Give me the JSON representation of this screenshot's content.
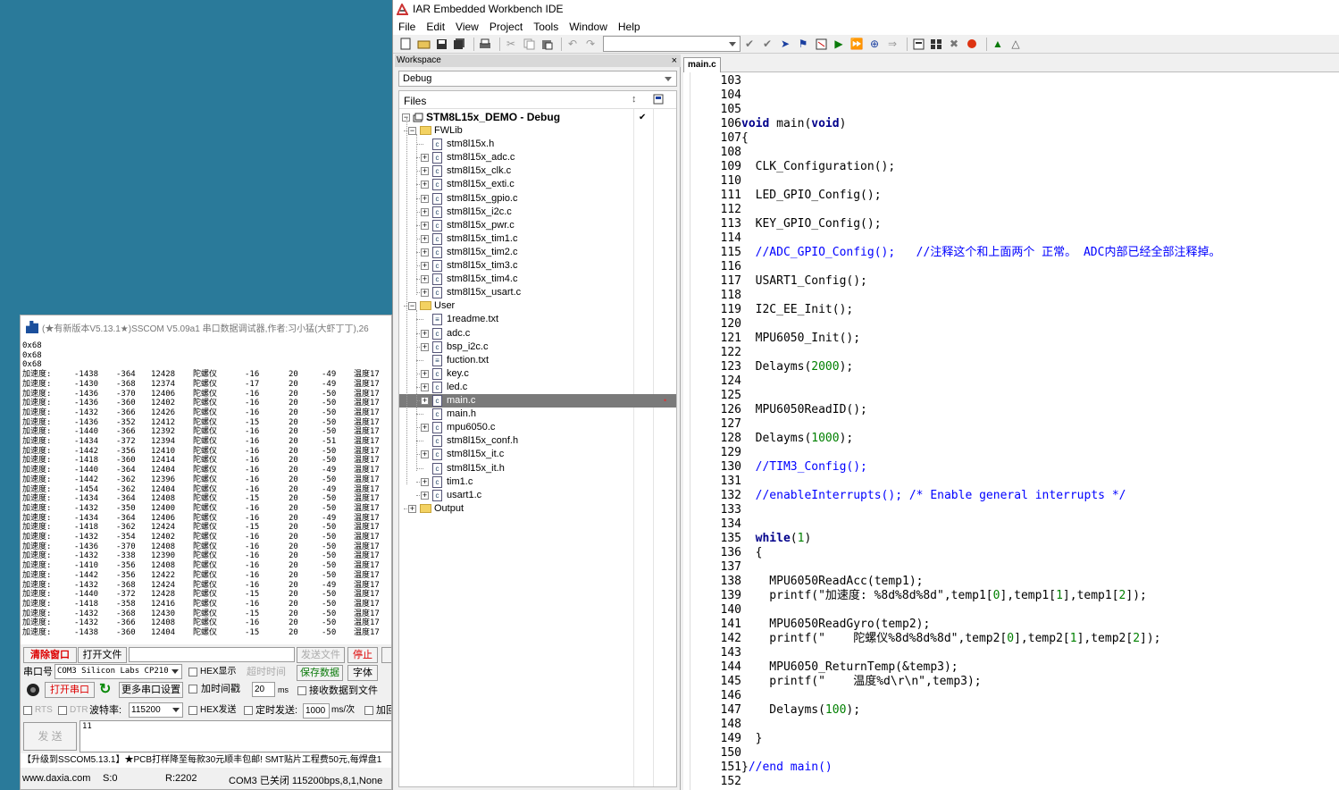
{
  "iar": {
    "title": "IAR Embedded Workbench IDE",
    "menu": [
      "File",
      "Edit",
      "View",
      "Project",
      "Tools",
      "Window",
      "Help"
    ],
    "workspace": {
      "header": "Workspace",
      "close": "×",
      "config": "Debug",
      "files_label": "Files",
      "project": "STM8L15x_DEMO - Debug",
      "project_check": "✔",
      "tree": [
        {
          "label": "FWLib",
          "type": "folder",
          "level": 1,
          "exp": "−"
        },
        {
          "label": "stm8l15x.h",
          "type": "file",
          "level": 2,
          "exp": ""
        },
        {
          "label": "stm8l15x_adc.c",
          "type": "file",
          "level": 2,
          "exp": "+"
        },
        {
          "label": "stm8l15x_clk.c",
          "type": "file",
          "level": 2,
          "exp": "+"
        },
        {
          "label": "stm8l15x_exti.c",
          "type": "file",
          "level": 2,
          "exp": "+"
        },
        {
          "label": "stm8l15x_gpio.c",
          "type": "file",
          "level": 2,
          "exp": "+"
        },
        {
          "label": "stm8l15x_i2c.c",
          "type": "file",
          "level": 2,
          "exp": "+"
        },
        {
          "label": "stm8l15x_pwr.c",
          "type": "file",
          "level": 2,
          "exp": "+"
        },
        {
          "label": "stm8l15x_tim1.c",
          "type": "file",
          "level": 2,
          "exp": "+"
        },
        {
          "label": "stm8l15x_tim2.c",
          "type": "file",
          "level": 2,
          "exp": "+"
        },
        {
          "label": "stm8l15x_tim3.c",
          "type": "file",
          "level": 2,
          "exp": "+"
        },
        {
          "label": "stm8l15x_tim4.c",
          "type": "file",
          "level": 2,
          "exp": "+"
        },
        {
          "label": "stm8l15x_usart.c",
          "type": "file",
          "level": 2,
          "exp": "+"
        },
        {
          "label": "User",
          "type": "folder",
          "level": 1,
          "exp": "−"
        },
        {
          "label": "1readme.txt",
          "type": "txt",
          "level": 2,
          "exp": ""
        },
        {
          "label": "adc.c",
          "type": "file",
          "level": 2,
          "exp": "+"
        },
        {
          "label": "bsp_i2c.c",
          "type": "file",
          "level": 2,
          "exp": "+"
        },
        {
          "label": "fuction.txt",
          "type": "txt",
          "level": 2,
          "exp": ""
        },
        {
          "label": "key.c",
          "type": "file",
          "level": 2,
          "exp": "+"
        },
        {
          "label": "led.c",
          "type": "file",
          "level": 2,
          "exp": "+"
        },
        {
          "label": "main.c",
          "type": "file",
          "level": 2,
          "exp": "+",
          "selected": true
        },
        {
          "label": "main.h",
          "type": "file",
          "level": 2,
          "exp": ""
        },
        {
          "label": "mpu6050.c",
          "type": "file",
          "level": 2,
          "exp": "+"
        },
        {
          "label": "stm8l15x_conf.h",
          "type": "file",
          "level": 2,
          "exp": ""
        },
        {
          "label": "stm8l15x_it.c",
          "type": "file",
          "level": 2,
          "exp": "+"
        },
        {
          "label": "stm8l15x_it.h",
          "type": "file",
          "level": 2,
          "exp": ""
        },
        {
          "label": "tim1.c",
          "type": "file",
          "level": 2,
          "exp": "+"
        },
        {
          "label": "usart1.c",
          "type": "file",
          "level": 2,
          "exp": "+"
        },
        {
          "label": "Output",
          "type": "folder",
          "level": 1,
          "exp": "+"
        }
      ]
    },
    "editor": {
      "tab": "main.c",
      "lines": [
        {
          "n": "103",
          "code": ""
        },
        {
          "n": "104",
          "code": ""
        },
        {
          "n": "105",
          "code": ""
        },
        {
          "n": "106",
          "code": "void main(void)"
        },
        {
          "n": "107",
          "code": "{"
        },
        {
          "n": "108",
          "code": ""
        },
        {
          "n": "109",
          "code": "  CLK_Configuration();"
        },
        {
          "n": "110",
          "code": ""
        },
        {
          "n": "111",
          "code": "  LED_GPIO_Config();"
        },
        {
          "n": "112",
          "code": ""
        },
        {
          "n": "113",
          "code": "  KEY_GPIO_Config();"
        },
        {
          "n": "114",
          "code": ""
        },
        {
          "n": "115",
          "code": "  //ADC_GPIO_Config();   //注释这个和上面两个 正常。 ADC内部已经全部注释掉。"
        },
        {
          "n": "116",
          "code": ""
        },
        {
          "n": "117",
          "code": "  USART1_Config();"
        },
        {
          "n": "118",
          "code": ""
        },
        {
          "n": "119",
          "code": "  I2C_EE_Init();"
        },
        {
          "n": "120",
          "code": ""
        },
        {
          "n": "121",
          "code": "  MPU6050_Init();"
        },
        {
          "n": "122",
          "code": ""
        },
        {
          "n": "123",
          "code": "  Delayms(2000);"
        },
        {
          "n": "124",
          "code": ""
        },
        {
          "n": "125",
          "code": ""
        },
        {
          "n": "126",
          "code": "  MPU6050ReadID();"
        },
        {
          "n": "127",
          "code": ""
        },
        {
          "n": "128",
          "code": "  Delayms(1000);"
        },
        {
          "n": "129",
          "code": ""
        },
        {
          "n": "130",
          "code": "  //TIM3_Config();"
        },
        {
          "n": "131",
          "code": ""
        },
        {
          "n": "132",
          "code": "  //enableInterrupts(); /* Enable general interrupts */"
        },
        {
          "n": "133",
          "code": ""
        },
        {
          "n": "134",
          "code": ""
        },
        {
          "n": "135",
          "code": "  while(1)"
        },
        {
          "n": "136",
          "code": "  {"
        },
        {
          "n": "137",
          "code": ""
        },
        {
          "n": "138",
          "code": "    MPU6050ReadAcc(temp1);"
        },
        {
          "n": "139",
          "code": "    printf(\"加速度: %8d%8d%8d\",temp1[0],temp1[1],temp1[2]);"
        },
        {
          "n": "140",
          "code": ""
        },
        {
          "n": "141",
          "code": "    MPU6050ReadGyro(temp2);"
        },
        {
          "n": "142",
          "code": "    printf(\"    陀螺仪%8d%8d%8d\",temp2[0],temp2[1],temp2[2]);"
        },
        {
          "n": "143",
          "code": ""
        },
        {
          "n": "144",
          "code": "    MPU6050_ReturnTemp(&temp3);"
        },
        {
          "n": "145",
          "code": "    printf(\"    温度%d\\r\\n\",temp3);"
        },
        {
          "n": "146",
          "code": ""
        },
        {
          "n": "147",
          "code": "    Delayms(100);"
        },
        {
          "n": "148",
          "code": ""
        },
        {
          "n": "149",
          "code": "  }"
        },
        {
          "n": "150",
          "code": ""
        },
        {
          "n": "151",
          "code": "}//end main()"
        },
        {
          "n": "152",
          "code": ""
        }
      ]
    }
  },
  "sscom": {
    "title": "(★有新版本V5.13.1★)SSCOM V5.09a1 串口数据调试器,作者:习小猛(大虾丁丁),26",
    "output_header": [
      "0x68",
      "0x68",
      "0x68"
    ],
    "rows": [
      [
        "加速度:",
        "-1438",
        "-364",
        "12428",
        "陀螺仪",
        "-16",
        "20",
        "-49",
        "温度17"
      ],
      [
        "加速度:",
        "-1430",
        "-368",
        "12374",
        "陀螺仪",
        "-17",
        "20",
        "-49",
        "温度17"
      ],
      [
        "加速度:",
        "-1436",
        "-370",
        "12406",
        "陀螺仪",
        "-16",
        "20",
        "-50",
        "温度17"
      ],
      [
        "加速度:",
        "-1436",
        "-360",
        "12402",
        "陀螺仪",
        "-16",
        "20",
        "-50",
        "温度17"
      ],
      [
        "加速度:",
        "-1432",
        "-366",
        "12426",
        "陀螺仪",
        "-16",
        "20",
        "-50",
        "温度17"
      ],
      [
        "加速度:",
        "-1436",
        "-352",
        "12412",
        "陀螺仪",
        "-15",
        "20",
        "-50",
        "温度17"
      ],
      [
        "加速度:",
        "-1440",
        "-366",
        "12392",
        "陀螺仪",
        "-16",
        "20",
        "-50",
        "温度17"
      ],
      [
        "加速度:",
        "-1434",
        "-372",
        "12394",
        "陀螺仪",
        "-16",
        "20",
        "-51",
        "温度17"
      ],
      [
        "加速度:",
        "-1442",
        "-356",
        "12410",
        "陀螺仪",
        "-16",
        "20",
        "-50",
        "温度17"
      ],
      [
        "加速度:",
        "-1418",
        "-360",
        "12414",
        "陀螺仪",
        "-16",
        "20",
        "-50",
        "温度17"
      ],
      [
        "加速度:",
        "-1440",
        "-364",
        "12404",
        "陀螺仪",
        "-16",
        "20",
        "-49",
        "温度17"
      ],
      [
        "加速度:",
        "-1442",
        "-362",
        "12396",
        "陀螺仪",
        "-16",
        "20",
        "-50",
        "温度17"
      ],
      [
        "加速度:",
        "-1454",
        "-362",
        "12404",
        "陀螺仪",
        "-16",
        "20",
        "-49",
        "温度17"
      ],
      [
        "加速度:",
        "-1434",
        "-364",
        "12408",
        "陀螺仪",
        "-15",
        "20",
        "-50",
        "温度17"
      ],
      [
        "加速度:",
        "-1432",
        "-350",
        "12400",
        "陀螺仪",
        "-16",
        "20",
        "-50",
        "温度17"
      ],
      [
        "加速度:",
        "-1434",
        "-364",
        "12406",
        "陀螺仪",
        "-16",
        "20",
        "-49",
        "温度17"
      ],
      [
        "加速度:",
        "-1418",
        "-362",
        "12424",
        "陀螺仪",
        "-15",
        "20",
        "-50",
        "温度17"
      ],
      [
        "加速度:",
        "-1432",
        "-354",
        "12402",
        "陀螺仪",
        "-16",
        "20",
        "-50",
        "温度17"
      ],
      [
        "加速度:",
        "-1436",
        "-370",
        "12408",
        "陀螺仪",
        "-16",
        "20",
        "-50",
        "温度17"
      ],
      [
        "加速度:",
        "-1432",
        "-338",
        "12390",
        "陀螺仪",
        "-16",
        "20",
        "-50",
        "温度17"
      ],
      [
        "加速度:",
        "-1410",
        "-356",
        "12408",
        "陀螺仪",
        "-16",
        "20",
        "-50",
        "温度17"
      ],
      [
        "加速度:",
        "-1442",
        "-356",
        "12422",
        "陀螺仪",
        "-16",
        "20",
        "-50",
        "温度17"
      ],
      [
        "加速度:",
        "-1432",
        "-368",
        "12424",
        "陀螺仪",
        "-16",
        "20",
        "-49",
        "温度17"
      ],
      [
        "加速度:",
        "-1440",
        "-372",
        "12428",
        "陀螺仪",
        "-15",
        "20",
        "-50",
        "温度17"
      ],
      [
        "加速度:",
        "-1418",
        "-358",
        "12416",
        "陀螺仪",
        "-16",
        "20",
        "-50",
        "温度17"
      ],
      [
        "加速度:",
        "-1432",
        "-368",
        "12430",
        "陀螺仪",
        "-15",
        "20",
        "-50",
        "温度17"
      ],
      [
        "加速度:",
        "-1432",
        "-366",
        "12408",
        "陀螺仪",
        "-16",
        "20",
        "-50",
        "温度17"
      ],
      [
        "加速度:",
        "-1438",
        "-360",
        "12404",
        "陀螺仪",
        "-15",
        "20",
        "-50",
        "温度17"
      ]
    ],
    "controls": {
      "clear_window": "清除窗口",
      "open_file": "打开文件",
      "send_file": "发送文件",
      "stop": "停止",
      "port_label": "串口号",
      "port_value": "COM3 Silicon Labs CP210",
      "hex_display": "HEX显示",
      "timeout_label": "超时时间",
      "save_data": "保存数据",
      "font": "字体",
      "open_port": "打开串口",
      "more_settings": "更多串口设置",
      "add_timestamp": "加时间戳",
      "ms_value": "20",
      "ms_unit": "ms",
      "recv_to_file": "接收数据到文件",
      "rts": "RTS",
      "dtr": "DTR",
      "baud_label": "波特率:",
      "baud_value": "115200",
      "hex_send": "HEX发送",
      "timed_send": "定时发送:",
      "interval_value": "1000",
      "interval_unit": "ms/次",
      "add_newline": "加回",
      "send": "发 送",
      "send_text": "11"
    },
    "banner": "【升级到SSCOM5.13.1】★PCB打样降至每款30元顺丰包邮! SMT贴片工程费50元,每焊盘1",
    "status": {
      "site": "www.daxia.com",
      "sent": "S:0",
      "received": "R:2202",
      "port_state": "COM3 已关闭  115200bps,8,1,None"
    }
  }
}
